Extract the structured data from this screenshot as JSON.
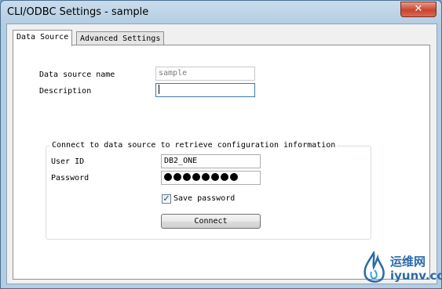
{
  "window": {
    "title": "CLI/ODBC Settings - sample",
    "close_glyph": "✕"
  },
  "tabs": [
    {
      "label": "Data Source",
      "active": true
    },
    {
      "label": "Advanced Settings",
      "active": false
    }
  ],
  "form": {
    "data_source_name_label": "Data source name",
    "data_source_name_value": "sample",
    "description_label": "Description",
    "description_value": ""
  },
  "connect_group": {
    "legend": "Connect to data source to retrieve configuration information",
    "user_id_label": "User ID",
    "user_id_value": "DB2_ONE",
    "password_label": "Password",
    "password_mask_count": 8,
    "save_password_label": "Save password",
    "save_password_checked": true,
    "connect_button": "Connect"
  },
  "watermark": {
    "icon": "flame-logo-icon",
    "text_cn": "运维网",
    "text_en": "iyunv.com"
  }
}
